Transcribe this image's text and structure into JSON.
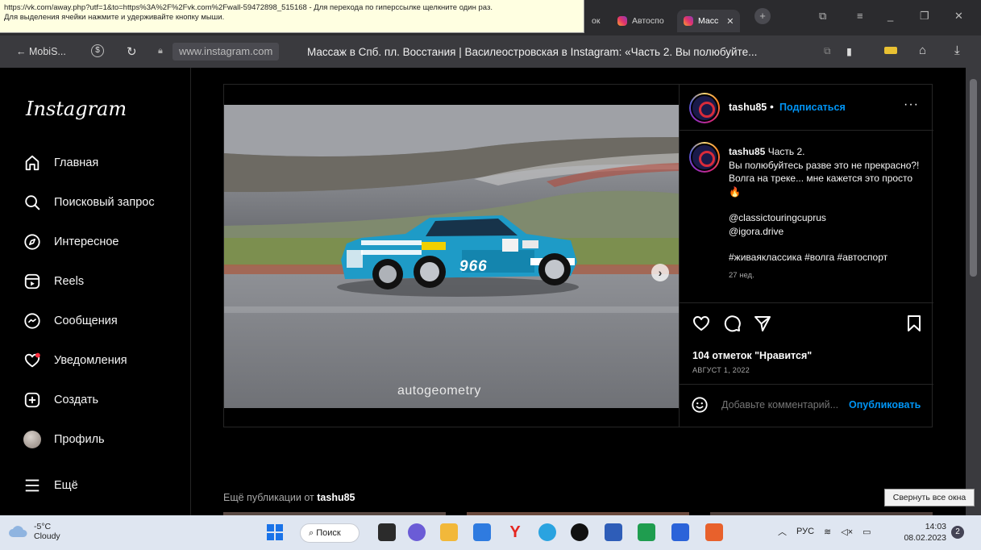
{
  "tooltip": {
    "line1": "https://vk.com/away.php?utf=1&to=https%3A%2F%2Fvk.com%2Fwall-59472898_515168 - Для перехода по гиперссылке щелкните один раз.",
    "line2": "Для выделения ячейки нажмите и удерживайте кнопку мыши."
  },
  "tabs": [
    {
      "label": "ок"
    },
    {
      "label": "Автоспо"
    },
    {
      "label": "Масс"
    }
  ],
  "nav": {
    "back_label": "← MobiS...",
    "url": "www.instagram.com",
    "page_title": "Массаж в Спб. пл. Восстания | Василеостровская в Instagram: «Часть 2. Вы полюбуйте..."
  },
  "sidebar": {
    "logo": "Instagram",
    "items": [
      {
        "label": "Главная"
      },
      {
        "label": "Поисковый запрос"
      },
      {
        "label": "Интересное"
      },
      {
        "label": "Reels"
      },
      {
        "label": "Сообщения"
      },
      {
        "label": "Уведомления"
      },
      {
        "label": "Создать"
      },
      {
        "label": "Профиль"
      },
      {
        "label": "Ещё"
      }
    ]
  },
  "post": {
    "username": "tashu85",
    "dot": "•",
    "follow_label": "Подписаться",
    "more": "···",
    "caption_user": "tashu85",
    "caption_lines": [
      "Часть 2.",
      "Вы полюбуйтесь разве это не прекрасно?! Волга на треке... мне кажется это просто 🔥",
      "@classictouringcuprus",
      "@igora.drive",
      "#живаяклассика #волга #автоспорт"
    ],
    "caption_time": "27 нед.",
    "likes": "104 отметок \"Нравится\"",
    "date": "АВГУСТ 1, 2022",
    "comment_placeholder": "Добавьте комментарий...",
    "publish_label": "Опубликовать",
    "watermark": "autogeometry",
    "car_number": "966",
    "next_arrow": "›"
  },
  "more_from": {
    "prefix": "Ещё публикации от ",
    "user": "tashu85"
  },
  "hide_windows_tip": "Свернуть все окна",
  "taskbar": {
    "temp": "-5°C",
    "weather": "Cloudy",
    "search_label": "Поиск",
    "lang": "РУС",
    "time": "14:03",
    "date": "08.02.2023",
    "notifications": "2"
  },
  "colors": {
    "ig_blue": "#0095f6",
    "bg": "#000000",
    "border": "#262626"
  }
}
